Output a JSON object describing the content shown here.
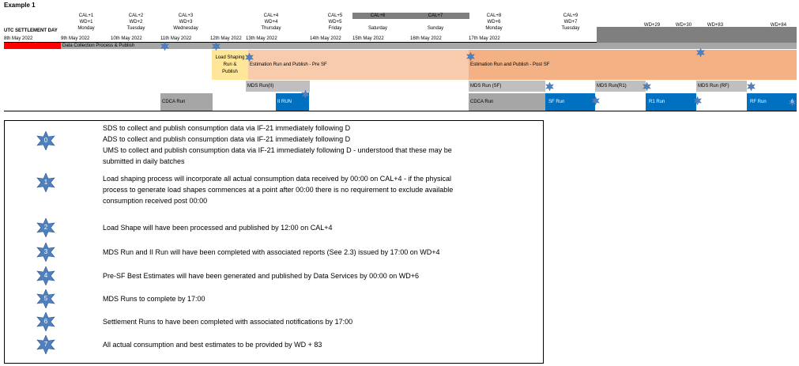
{
  "title": "Example 1",
  "header": {
    "row_label": "UTC SETTLEMENT DAY",
    "first_date": "8th May 2022",
    "columns": [
      {
        "cal": "CAL+1",
        "wd": "WD+1",
        "day": "Monday",
        "date": "9th May 2022"
      },
      {
        "cal": "CAL+2",
        "wd": "WD+2",
        "day": "Tuesday",
        "date": "10th May 2022"
      },
      {
        "cal": "CAL+3",
        "wd": "WD+3",
        "day": "Wednesday",
        "date": "11th May 2022"
      },
      {
        "cal": "",
        "wd": "",
        "day": "",
        "date": "12th May 2022"
      },
      {
        "cal": "CAL+4",
        "wd": "WD+4",
        "day": "Thursday",
        "date": "13th May 2022"
      },
      {
        "cal": "CAL+5",
        "wd": "WD+5",
        "day": "Friday",
        "date": "14th May 2022"
      },
      {
        "cal": "CAL+6",
        "wd": "",
        "day": "Saturday",
        "date": "15th May 2022"
      },
      {
        "cal": "CAL+7",
        "wd": "",
        "day": "Sunday",
        "date": "16th May 2022"
      },
      {
        "cal": "CAL+8",
        "wd": "WD+6",
        "day": "Monday",
        "date": "17th May 2022"
      },
      {
        "cal": "CAL+9",
        "wd": "WD+7",
        "day": "Tuesday",
        "date": ""
      }
    ],
    "wd_extra": [
      "WD+29",
      "WD+30",
      "WD+83",
      "WD+84"
    ]
  },
  "bars": {
    "data_collection": "Data Collection Process & Publish",
    "load_shaping_1": "Load Shaping",
    "load_shaping_2": "Run &",
    "load_shaping_3": "Publish",
    "est_pre": "Estimation Run and Publish - Pre SF",
    "est_post": "Estimation Run and Publish - Post SF",
    "mds_ii": "MDS Run(II)",
    "mds_sf": "MDS Run (SF)",
    "mds_r1": "MDS Run(R1)",
    "mds_rf": "MDS Run (RF)",
    "cdca1": "CDCA Run",
    "ii_run": "II RUN",
    "cdca2": "CDCA Run",
    "sf_run": "SF Run",
    "r1_run": "R1 Run",
    "rf_run": "RF Run"
  },
  "legend": [
    {
      "num": "0",
      "lines": [
        "SDS to collect and publish consumption data via IF-21 immediately following D",
        "ADS to collect and publish consumption data via IF-21 immediately following D",
        "UMS to collect and publish consumption data via IF-21 immediately following D - understood that these may be",
        "submitted in daily batches"
      ]
    },
    {
      "num": "1",
      "lines": [
        "Load shaping process will incorporate all actual consumption data received by 00:00 on CAL+4 - if the physical",
        "process to generate load shapes commences at a point after 00:00 there is no requirement to exclude available",
        "consumption received post 00:00"
      ]
    },
    {
      "num": "2",
      "lines": [
        "Load Shape will have been processed and published by 12:00 on CAL+4"
      ]
    },
    {
      "num": "3",
      "lines": [
        "MDS Run and II Run will have been completed with associated reports (See 2.3) issued by 17:00 on WD+4"
      ]
    },
    {
      "num": "4",
      "lines": [
        "Pre-SF Best Estimates will have been generated and published by Data Services by 00:00 on WD+6"
      ]
    },
    {
      "num": "5",
      "lines": [
        "MDS Runs to complete by 17:00"
      ]
    },
    {
      "num": "6",
      "lines": [
        "Settlement Runs to have been completed with associated notifications by 17:00"
      ]
    },
    {
      "num": "7",
      "lines": [
        "All actual consumption and best estimates to be provided by WD + 83"
      ]
    }
  ],
  "colors": {
    "star": "#4f81bd",
    "red": "#ff0000",
    "gray": "#a6a6a6",
    "darkgray": "#7f7f7f",
    "orange": "#f4b183",
    "peach": "#f8cbad",
    "yellow": "#ffe699",
    "blue": "#0070c0",
    "lightgray": "#bfbfbf"
  }
}
